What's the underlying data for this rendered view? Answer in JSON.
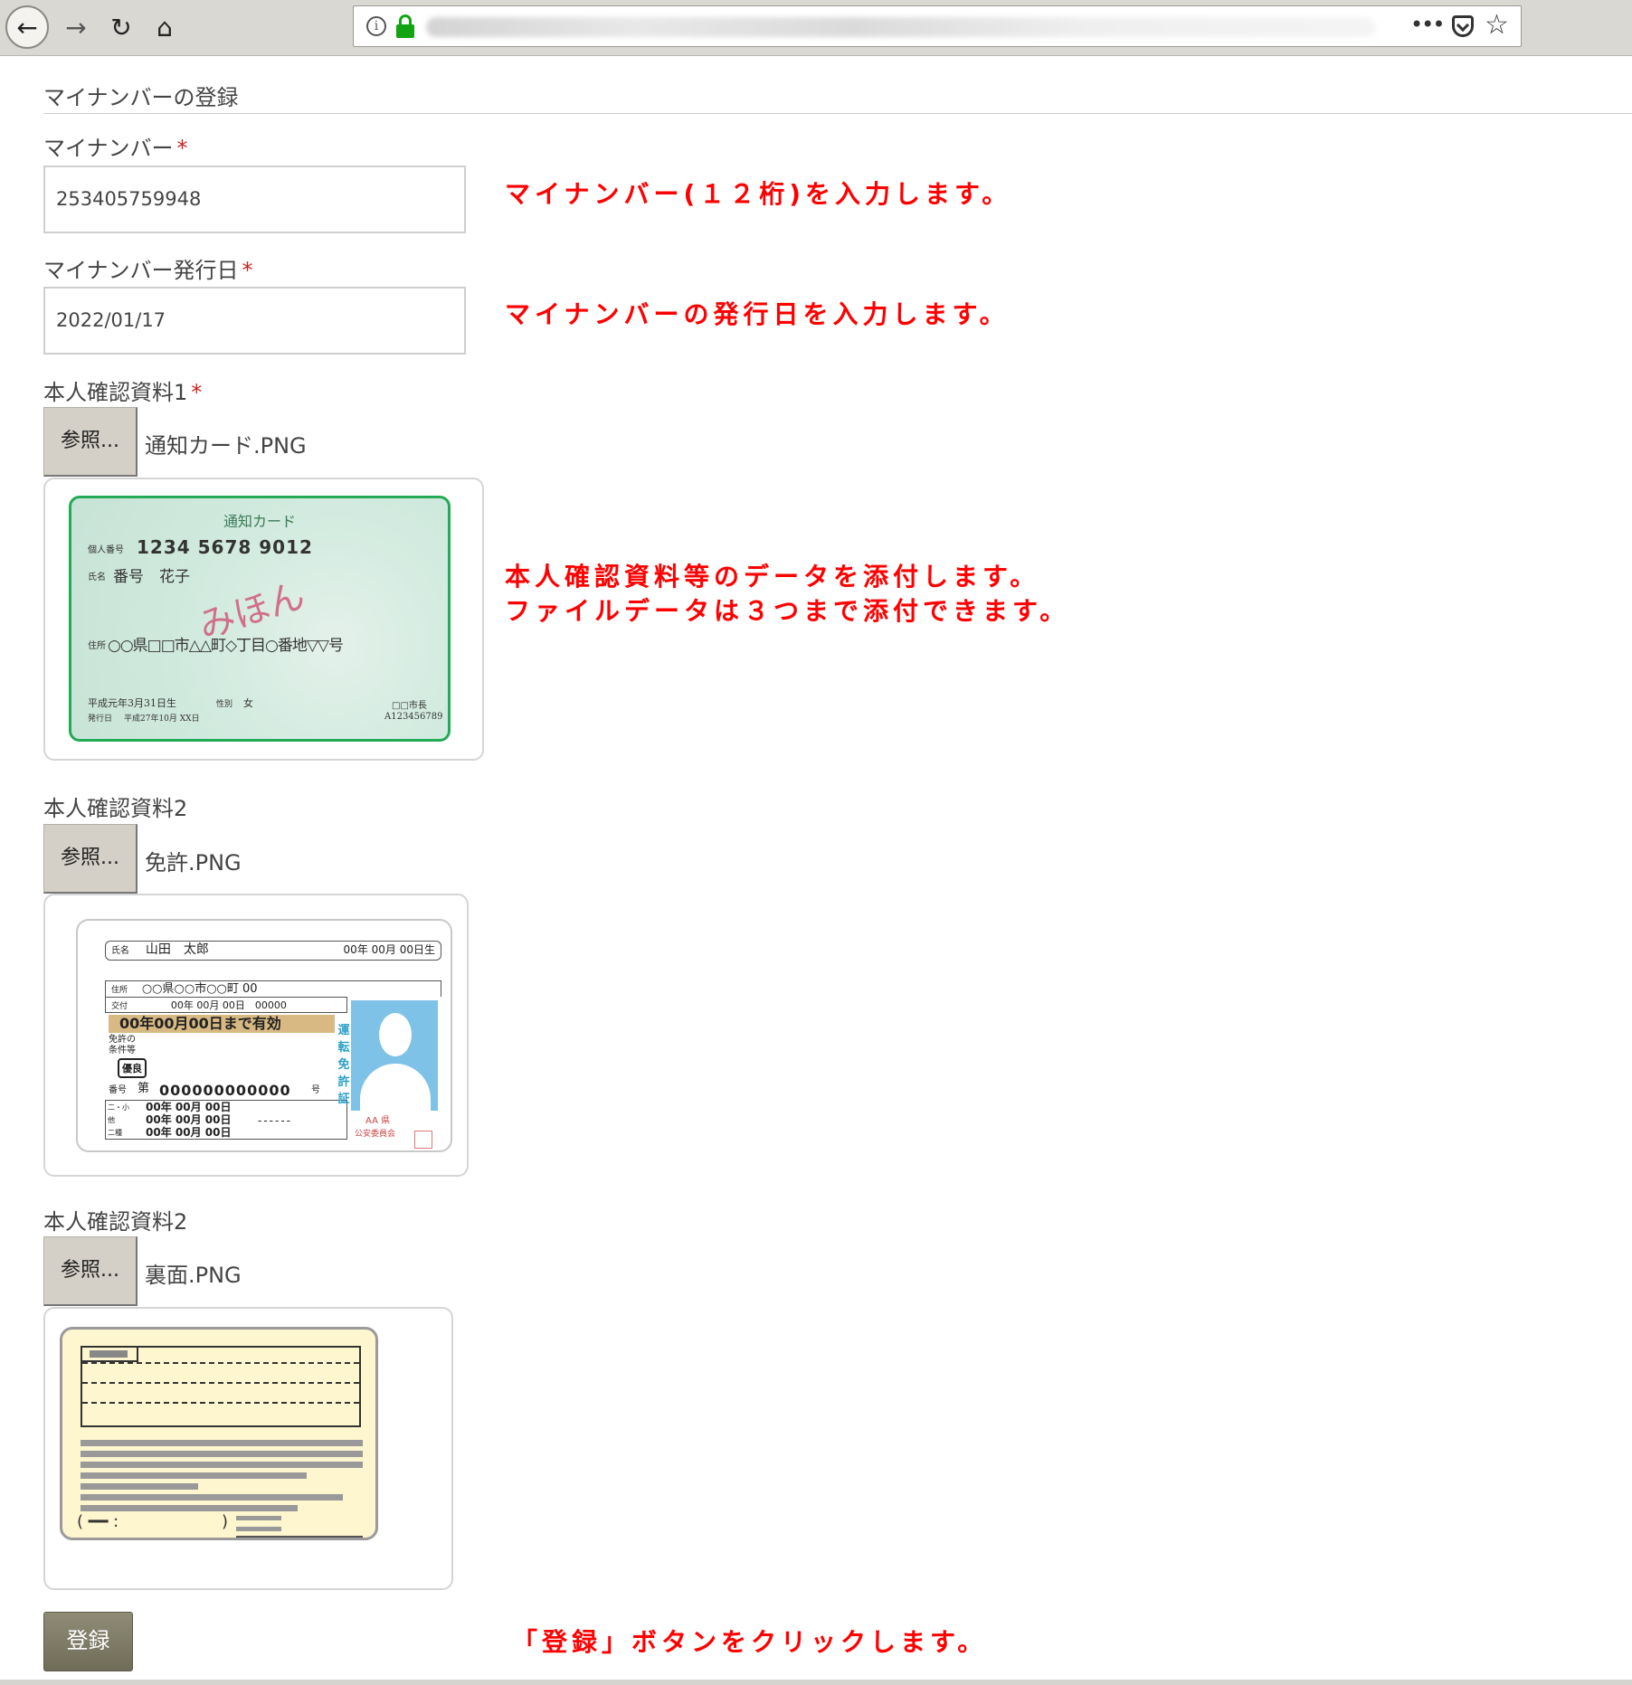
{
  "browser": {
    "back_icon": "←",
    "forward_icon": "→",
    "reload_icon": "↻",
    "home_icon": "⌂",
    "info_icon": "i",
    "more_icon": "•••",
    "star_icon": "☆"
  },
  "form": {
    "section_title": "マイナンバーの登録",
    "required_mark": "*",
    "my_number": {
      "label": "マイナンバー",
      "value": "253405759948"
    },
    "issue_date": {
      "label": "マイナンバー発行日",
      "value": "2022/01/17"
    },
    "attachments": [
      {
        "label": "本人確認資料1",
        "required": true,
        "browse_label": "参照...",
        "file_name": "通知カード.PNG"
      },
      {
        "label": "本人確認資料2",
        "required": false,
        "browse_label": "参照...",
        "file_name": "免許.PNG"
      },
      {
        "label": "本人確認資料2",
        "required": false,
        "browse_label": "参照...",
        "file_name": "裏面.PNG"
      }
    ],
    "submit_label": "登録"
  },
  "annotations": {
    "my_number": "マイナンバー(１２桁)を入力します。",
    "issue_date": "マイナンバーの発行日を入力します。",
    "attachments_line1": "本人確認資料等のデータを添付します。",
    "attachments_line2": "ファイルデータは３つまで添付できます。",
    "submit": "「登録」ボタンをクリックします。"
  },
  "card_notice": {
    "title": "通知カード",
    "number_label": "個人番号",
    "number": "1234 5678 9012",
    "name_label": "氏名",
    "name": "番号　花子",
    "stamp": "みほん",
    "address_label": "住所",
    "address": "○○県□□市△△町◇丁目○番地▽▽号",
    "birth": "平成元年3月31日生",
    "sex_label": "性別",
    "sex": "女",
    "issue_label": "発行日",
    "issue": "平成27年10月 XX日",
    "mayor": "□□市長",
    "serial": "A123456789"
  },
  "card_license": {
    "name_label": "氏名",
    "name": "山田　太郎",
    "birth": "00年 00月 00日生",
    "address_label": "住所",
    "address": "○○県○○市○○町 00",
    "issue_label": "交付",
    "issue": "00年 00月 00日　00000",
    "valid": "00年00月00日まで有効",
    "conditions_1": "免許の",
    "conditions_2": "条件等",
    "badge": "優良",
    "number_label_1": "番号",
    "number_label_2": "第",
    "number": "000000000000",
    "number_suffix": "号",
    "dates": "00年 00月 00日",
    "categories_1": "二・小",
    "categories_2": "他",
    "categories_3": "二種",
    "vertical_title": "運転免許証",
    "authority_1": "AA 県",
    "authority_2": "公安委員会"
  },
  "card_back": {
    "footer_left": "(  ━━  :",
    "footer_right": ")"
  },
  "colors": {
    "annotation": "#ff0000",
    "required": "#cc2222",
    "card_border": "#22aa55",
    "submit_button": "#7a7864",
    "toolbar": "#dad8d3",
    "lock": "#12a412"
  }
}
